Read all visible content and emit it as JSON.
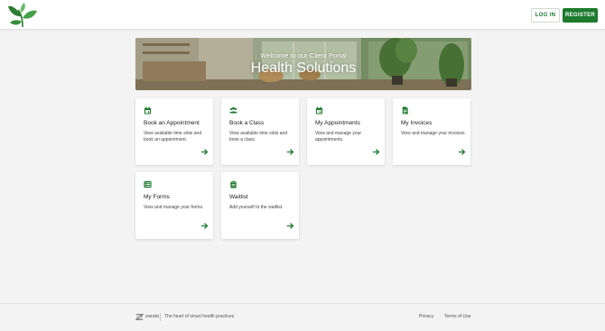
{
  "header": {
    "login_label": "LOG IN",
    "register_label": "REGISTER"
  },
  "hero": {
    "subtitle": "Welcome to our Client Portal",
    "title": "Health Solutions"
  },
  "cards": [
    {
      "title": "Book an Appointment",
      "description": "View available time slots and book an appointment.",
      "icon": "calendar-icon"
    },
    {
      "title": "Book a Class",
      "description": "View available time slots and book a class.",
      "icon": "people-icon"
    },
    {
      "title": "My Appointments",
      "description": "View and manage your appointments.",
      "icon": "calendar-icon"
    },
    {
      "title": "My Invoices",
      "description": "View and manage your invoices.",
      "icon": "invoice-icon"
    },
    {
      "title": "My Forms",
      "description": "View and manage your forms.",
      "icon": "forms-icon"
    },
    {
      "title": "Waitlist",
      "description": "Add yourself to the waitlist.",
      "icon": "clipboard-icon"
    }
  ],
  "footer": {
    "brand": "zanda",
    "tagline": "The heart of smart health practices",
    "privacy": "Privacy",
    "terms": "Terms of Use"
  },
  "colors": {
    "accent": "#1e7a2e",
    "background": "#f3f3f3"
  }
}
